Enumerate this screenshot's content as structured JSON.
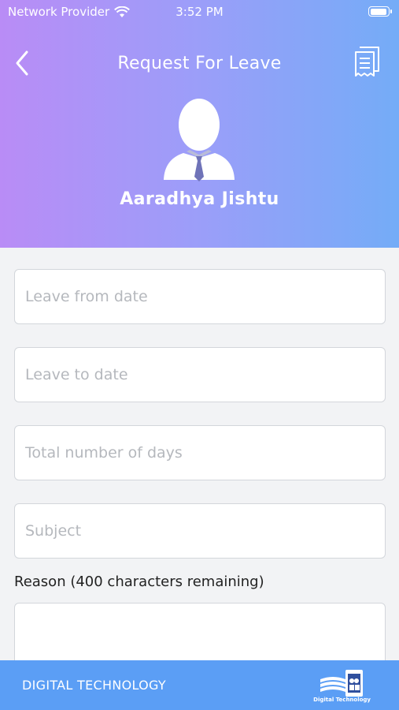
{
  "status_bar": {
    "carrier": "Network Provider",
    "time": "3:52 PM"
  },
  "header": {
    "title": "Request For Leave",
    "user_name": "Aaradhya Jishtu",
    "icons": [
      "chevron-left-icon",
      "document-list-icon",
      "person-avatar-icon"
    ]
  },
  "form": {
    "leave_from_placeholder": "Leave from date",
    "leave_to_placeholder": "Leave to date",
    "total_days_placeholder": "Total number of days",
    "subject_placeholder": "Subject",
    "reason_label": "Reason (400 characters remaining)"
  },
  "footer": {
    "label": "DIGITAL TECHNOLOGY",
    "logo_caption": "Digital Technology"
  },
  "colors": {
    "gradient_start": "#b98cf6",
    "gradient_end": "#74acf7",
    "footer_bg": "#5b9ef5"
  }
}
